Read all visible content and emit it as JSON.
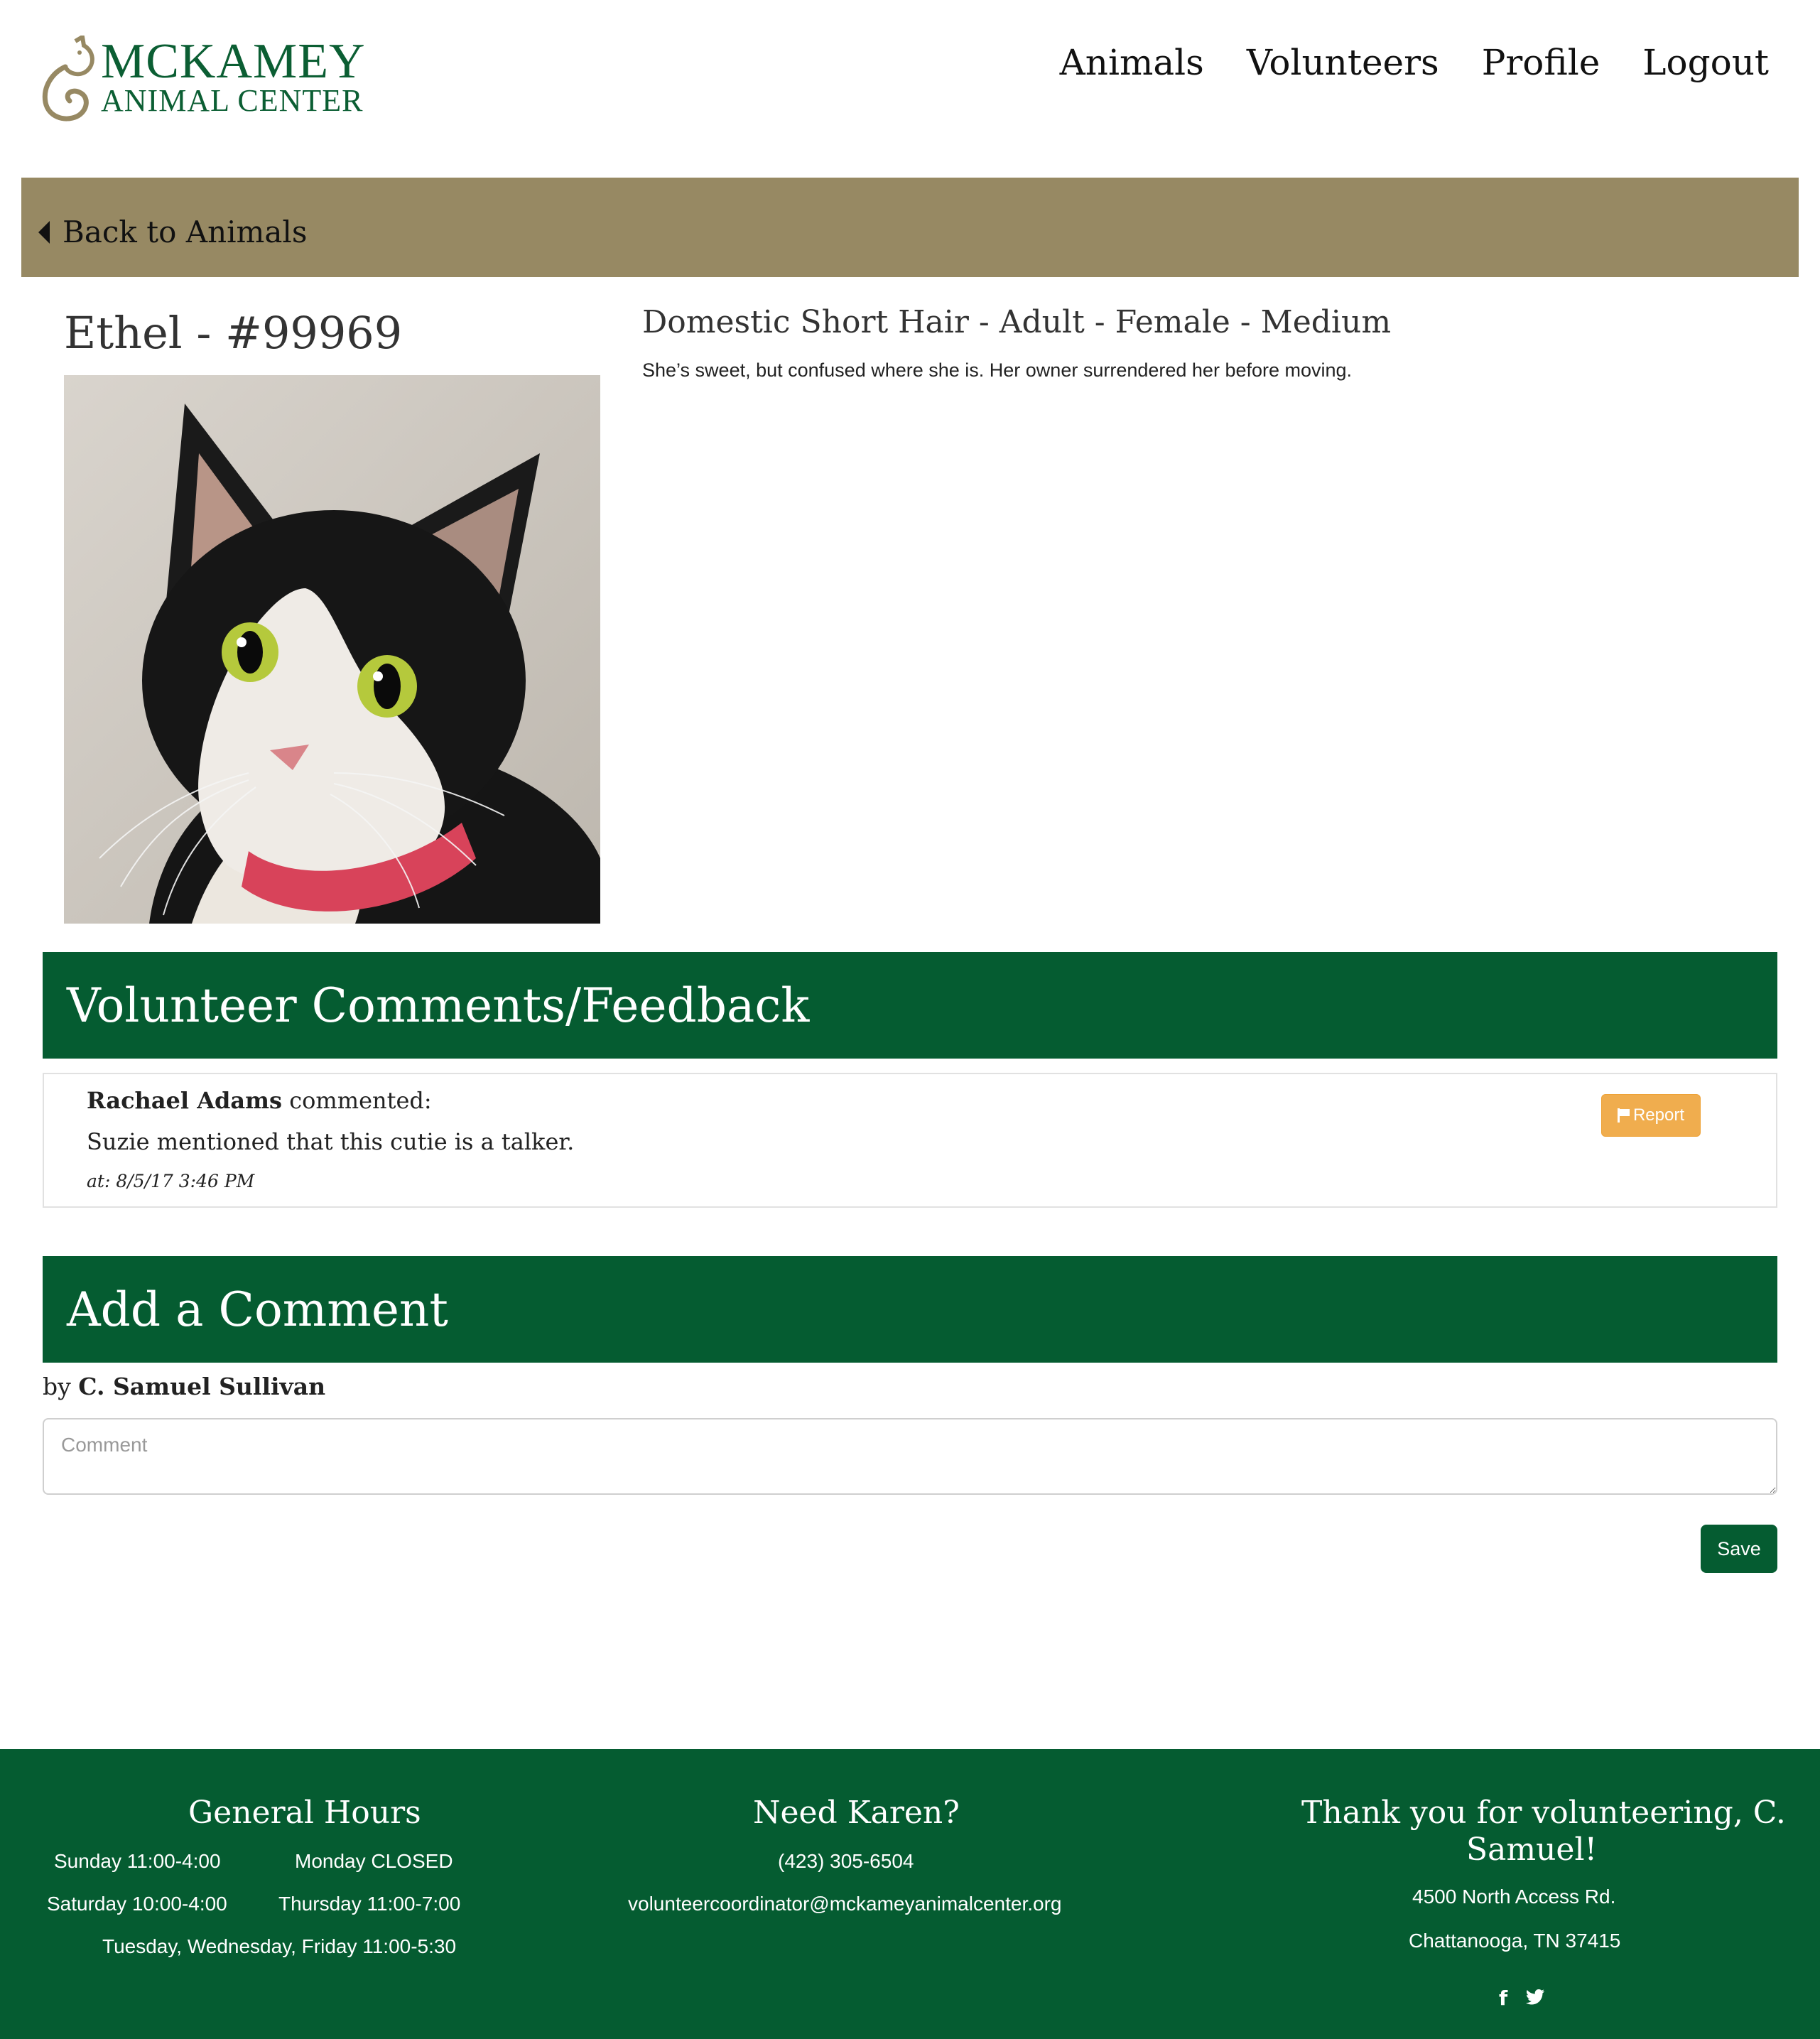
{
  "header": {
    "logo_line1": "MCKAMEY",
    "logo_line2": "ANIMAL CENTER",
    "nav": [
      "Animals",
      "Volunteers",
      "Profile",
      "Logout"
    ]
  },
  "back_bar": {
    "label": "Back to Animals",
    "color": "#978963"
  },
  "animal": {
    "title": "Ethel - #99969",
    "info": "Domestic Short Hair - Adult - Female - Medium",
    "description": "She’s sweet, but confused where she is. Her owner surrendered her before moving."
  },
  "comments_section": {
    "title": "Volunteer Comments/Feedback",
    "comments": [
      {
        "author": "Rachael Adams",
        "verb": "commented:",
        "text": "Suzie mentioned that this cutie is a talker.",
        "time": "at: 8/5/17 3:46 PM",
        "report_label": "Report"
      }
    ]
  },
  "add_comment": {
    "title": "Add a Comment",
    "by_prefix": "by",
    "by_name": "C. Samuel Sullivan",
    "placeholder": "Comment",
    "save_label": "Save"
  },
  "footer": {
    "hours_title": "General Hours",
    "hours": [
      "Sunday 11:00-4:00",
      "Monday CLOSED",
      "Saturday 10:00-4:00",
      "Thursday 11:00-7:00",
      "Tuesday, Wednesday, Friday 11:00-5:30"
    ],
    "contact_title": "Need Karen?",
    "phone": "(423) 305-6504",
    "email": "volunteercoordinator@mckameyanimalcenter.org",
    "thanks_title_line1": "Thank you for volunteering, C.",
    "thanks_title_line2": "Samuel!",
    "address_line1": "4500 North Access Rd.",
    "address_line2": "Chattanooga, TN 37415",
    "social_icons": [
      "facebook-icon",
      "twitter-icon"
    ]
  },
  "colors": {
    "brand_green": "#055c31",
    "logo_green": "#0b5e33",
    "report_orange": "#f0ad4e"
  }
}
